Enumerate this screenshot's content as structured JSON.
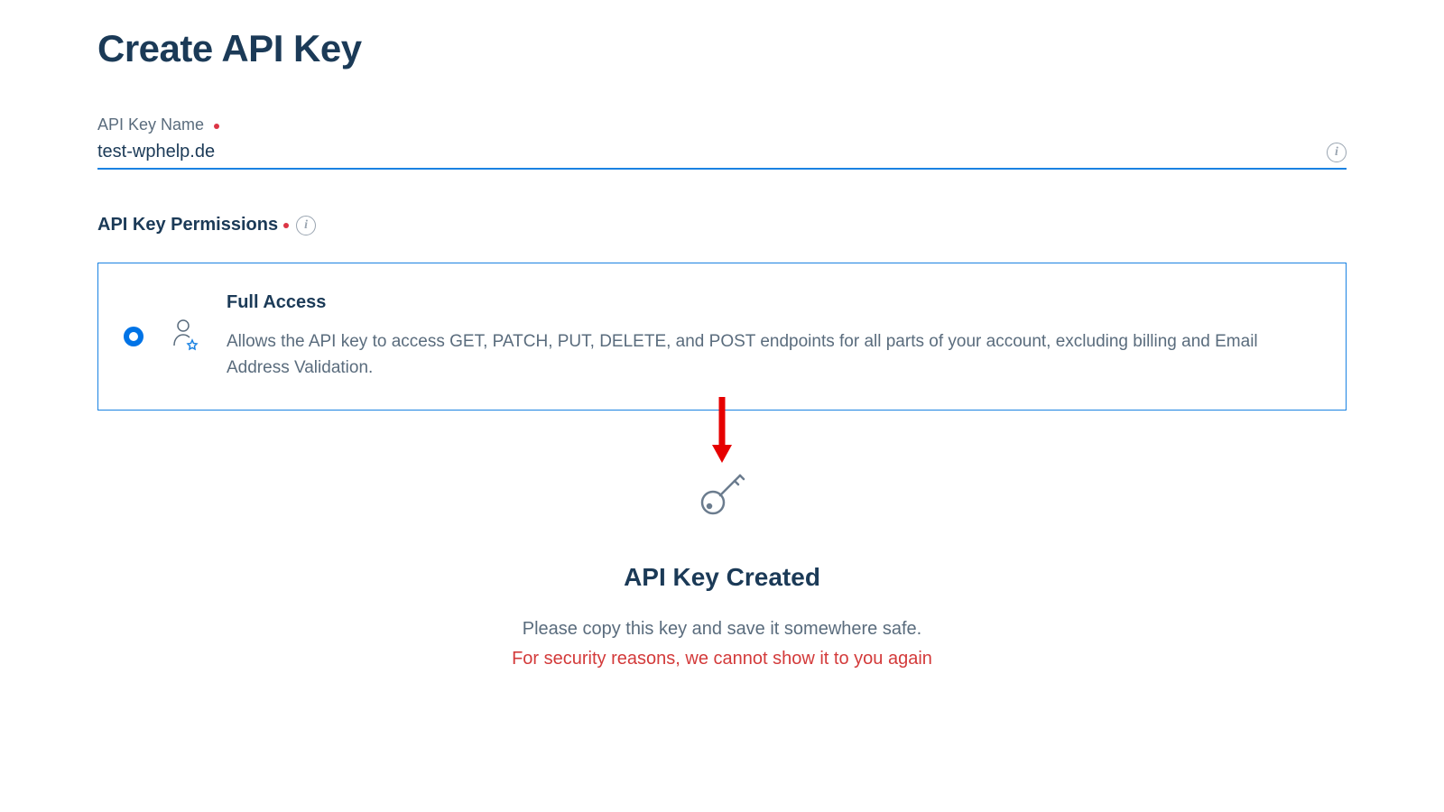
{
  "page": {
    "title": "Create API Key"
  },
  "form": {
    "name_label": "API Key Name",
    "name_value": "test-wphelp.de",
    "permissions_label": "API Key Permissions"
  },
  "permission": {
    "title": "Full Access",
    "description": "Allows the API key to access GET, PATCH, PUT, DELETE, and POST endpoints for all parts of your account, excluding billing and Email Address Validation."
  },
  "created": {
    "title": "API Key Created",
    "subtext": "Please copy this key and save it somewhere safe.",
    "warning": "For security reasons, we cannot show it to you again"
  }
}
